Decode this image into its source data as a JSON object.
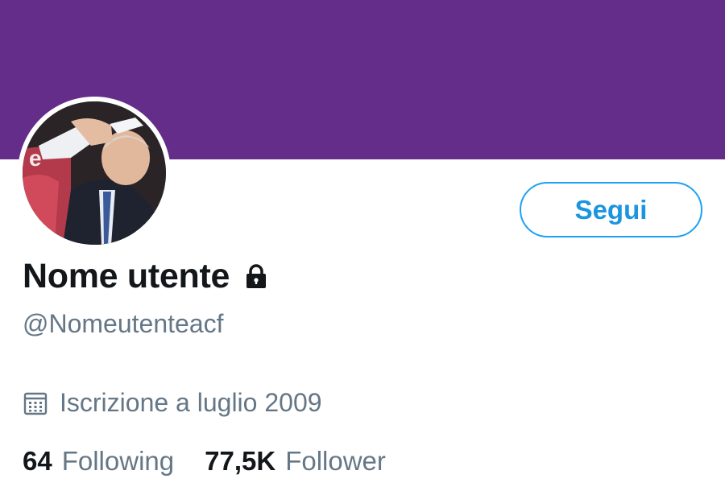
{
  "profile": {
    "display_name": "Nome utente",
    "handle": "@Nomeutenteacf",
    "joined": "Iscrizione a luglio 2009",
    "follow_label": "Segui",
    "following_count": "64",
    "following_label": "Following",
    "follower_count": "77,5K",
    "follower_label": "Follower",
    "protected_icon": "lock-icon",
    "joined_icon": "calendar-icon"
  },
  "colors": {
    "banner": "#652d8a",
    "accent": "#1da1f2",
    "secondary_text": "#657786",
    "primary_text": "#14171a"
  }
}
